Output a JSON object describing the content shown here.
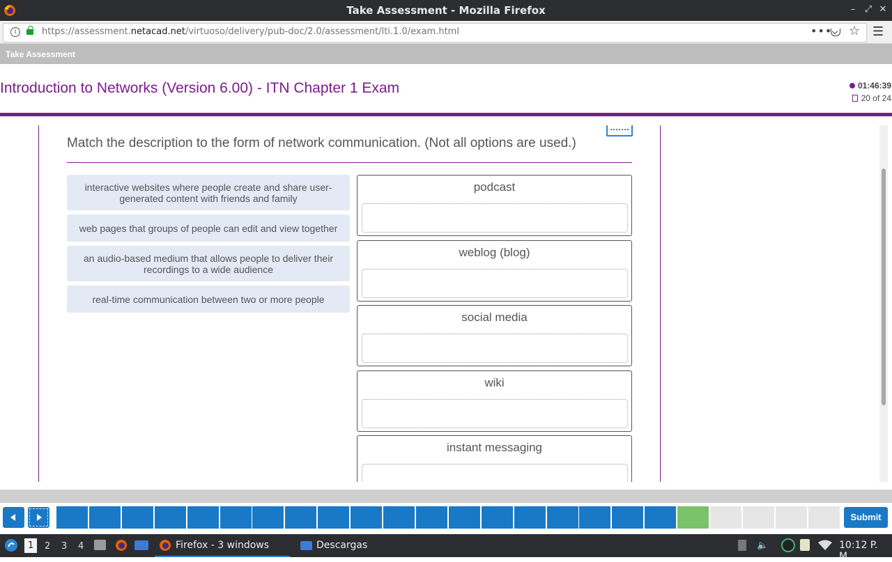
{
  "window": {
    "title": "Take Assessment - Mozilla Firefox",
    "controls": [
      "–",
      "⤢",
      "✕"
    ]
  },
  "browser": {
    "url_pre": "https://assessment.",
    "url_domain": "netacad.net",
    "url_post": "/virtuoso/delivery/pub-doc/2.0/assessment/lti.1.0/exam.html",
    "dots": "•••",
    "star": "☆",
    "menu": "☰"
  },
  "app": {
    "header": "Take Assessment",
    "exam_title": "Introduction to Networks (Version 6.00) - ITN Chapter 1 Exam",
    "timer": "01:46:39",
    "question_count": "20 of 24"
  },
  "question": {
    "text": "Match the description to the form of network communication. (Not all options are used.)",
    "options": [
      "interactive websites where people create and share user-generated content with friends and family",
      "web pages that groups of people can edit and view together",
      "an audio-based medium that allows people to deliver their recordings to a wide audience",
      "real-time communication between two or more people"
    ],
    "targets": [
      "podcast",
      "weblog (blog)",
      "social media",
      "wiki",
      "instant messaging"
    ]
  },
  "nav": {
    "submit_label": "Submit",
    "colors": {
      "answered": "#1a79c7",
      "current": "#7ac36a",
      "unanswered": "#e6e6e6"
    },
    "questions": [
      {
        "state": "answered"
      },
      {
        "state": "answered"
      },
      {
        "state": "answered"
      },
      {
        "state": "answered"
      },
      {
        "state": "answered"
      },
      {
        "state": "answered"
      },
      {
        "state": "answered"
      },
      {
        "state": "answered"
      },
      {
        "state": "answered"
      },
      {
        "state": "answered"
      },
      {
        "state": "answered"
      },
      {
        "state": "answered"
      },
      {
        "state": "answered"
      },
      {
        "state": "answered"
      },
      {
        "state": "answered"
      },
      {
        "state": "answered"
      },
      {
        "state": "answered"
      },
      {
        "state": "answered"
      },
      {
        "state": "answered"
      },
      {
        "state": "current"
      },
      {
        "state": "unanswered"
      },
      {
        "state": "unanswered"
      },
      {
        "state": "unanswered"
      },
      {
        "state": "unanswered"
      }
    ]
  },
  "taskbar": {
    "workspaces": [
      "1",
      "2",
      "3",
      "4"
    ],
    "tasks": [
      "Firefox - 3 windows",
      "Descargas"
    ],
    "clock": "10:12 P. M."
  }
}
